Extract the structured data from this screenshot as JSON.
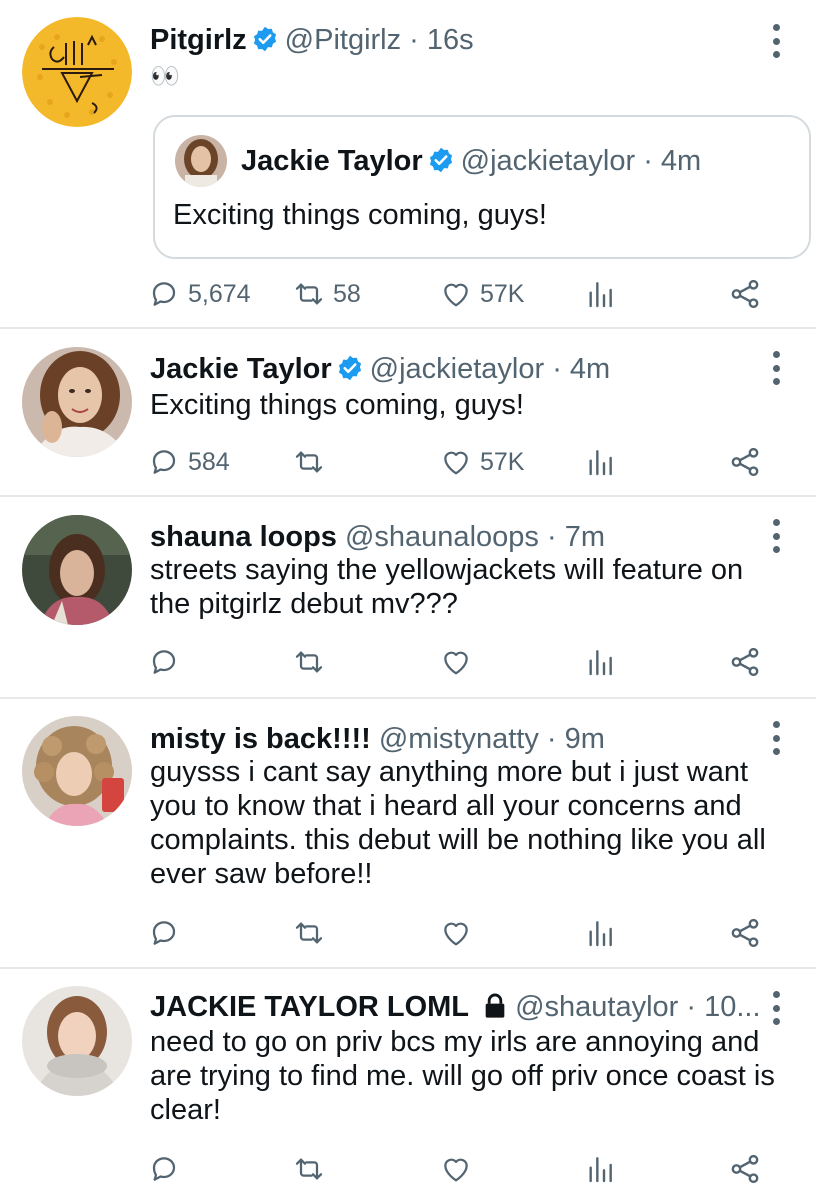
{
  "colors": {
    "verified": "#1d9bf0",
    "muted": "#536471",
    "text": "#0f1419",
    "divider": "#e6e8ea"
  },
  "tweets": [
    {
      "name": "Pitgirlz",
      "handle": "@Pitgirlz",
      "time": "16s",
      "verified": true,
      "text": "👀",
      "quote": {
        "name": "Jackie Taylor",
        "handle": "@jackietaylor",
        "time": "4m",
        "verified": true,
        "text": "Exciting things coming, guys!"
      },
      "stats": {
        "replies": "5,674",
        "retweets": "58",
        "likes": "57K"
      }
    },
    {
      "name": "Jackie Taylor",
      "handle": "@jackietaylor",
      "time": "4m",
      "verified": true,
      "text": "Exciting things coming, guys!",
      "stats": {
        "replies": "584",
        "retweets": "",
        "likes": "57K"
      }
    },
    {
      "name": "shauna loops",
      "handle": "@shaunaloops",
      "time": "7m",
      "text": "streets saying the yellowjackets will feature on the pitgirlz debut mv???"
    },
    {
      "name": "misty is back!!!!",
      "handle": "@mistynatty",
      "time": "9m",
      "text": "guysss i cant say anything more but i just want you to know that i heard all your concerns and complaints. this debut will be nothing like you all ever saw before!!"
    },
    {
      "name": "JACKIE TAYLOR LOML",
      "handle": "@shautaylor",
      "time": "10...",
      "protected": true,
      "text": "need to go on priv bcs my irls are annoying and are trying to find me. will go off priv once coast is clear!"
    }
  ],
  "icons": {
    "reply": "reply-icon",
    "retweet": "retweet-icon",
    "like": "like-icon",
    "analytics": "analytics-icon",
    "share": "share-icon",
    "more": "more-icon",
    "verified": "verified-badge-icon",
    "lock": "lock-icon"
  }
}
